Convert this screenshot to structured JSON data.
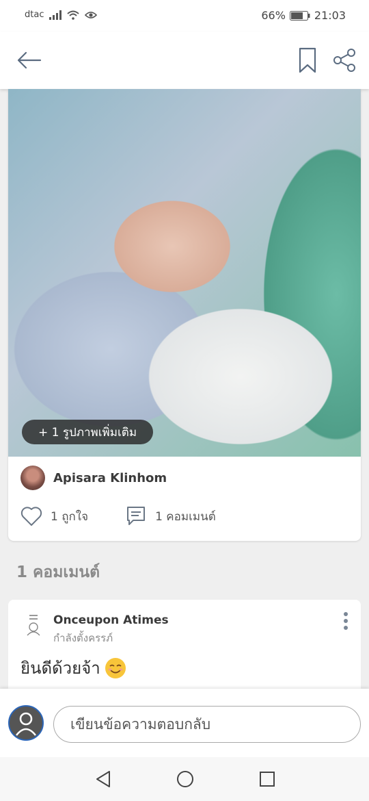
{
  "status_bar": {
    "carrier": "dtac",
    "battery": "66%",
    "time": "21:03"
  },
  "header": {
    "back_icon": "arrow-left-icon",
    "bookmark_icon": "bookmark-icon",
    "share_icon": "share-icon"
  },
  "post": {
    "more_photos_label": "+ 1 รูปภาพเพิ่มเติม",
    "author_name": "Apisara Klinhom",
    "likes_label": "1 ถูกใจ",
    "comments_label": "1 คอมเมนต์"
  },
  "comments_section": {
    "title": "1 คอมเมนต์",
    "items": [
      {
        "name": "Onceupon Atimes",
        "status": "กำลังตั้งครรภ์",
        "text": "ยินดีด้วยจ้า"
      }
    ]
  },
  "reply": {
    "placeholder": "เขียนข้อความตอบกลับ"
  },
  "colors": {
    "accent_ring": "#2c66b8",
    "background": "#efefef"
  }
}
